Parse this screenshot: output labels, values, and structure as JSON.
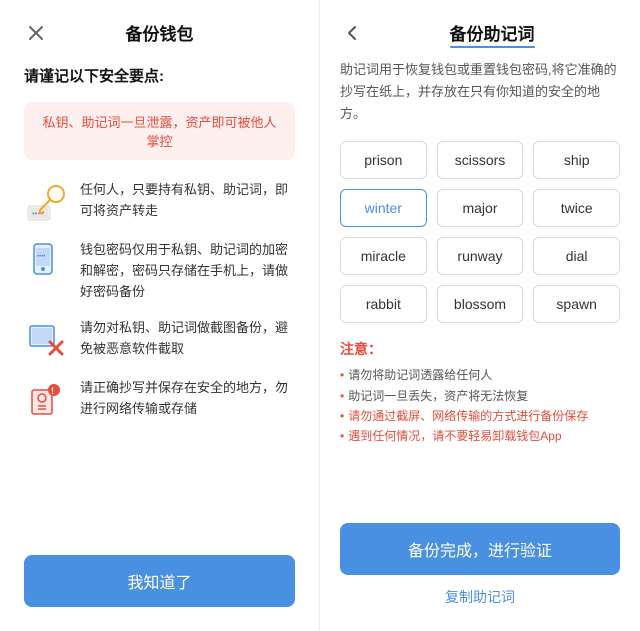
{
  "left": {
    "title": "备份钱包",
    "subtitle": "请谨记以下安全要点:",
    "warning": "私钥、助记词一旦泄露，资产即可被他人掌控",
    "security_items": [
      {
        "icon": "key-icon",
        "text": "任何人，只要持有私钥、助记词，即可将资产转走"
      },
      {
        "icon": "phone-icon",
        "text": "钱包密码仅用于私钥、助记词的加密和解密，密码只存储在手机上，请做好密码备份"
      },
      {
        "icon": "scan-icon",
        "text": "请勿对私钥、助记词做截图备份，避免被恶意软件截取"
      },
      {
        "icon": "save-icon",
        "text": "请正确抄写并保存在安全的地方，勿进行网络传输或存储"
      }
    ],
    "confirm_button": "我知道了"
  },
  "right": {
    "title": "备份助记词",
    "back_label": "‹",
    "description": "助记词用于恢复钱包或重置钱包密码,将它准确的抄写在纸上，并存放在只有你知道的安全的地方。",
    "words": [
      "prison",
      "scissors",
      "ship",
      "winter",
      "major",
      "twice",
      "miracle",
      "runway",
      "dial",
      "rabbit",
      "blossom",
      "spawn"
    ],
    "highlighted_word": "winter",
    "notes_title": "注意：",
    "notes": [
      {
        "text": "请勿将助记词透露给任何人",
        "red": false
      },
      {
        "text": "助记词一旦丢失，资产将无法恢复",
        "red": false
      },
      {
        "text": "请勿通过截屏、网络传输的方式进行备份保存",
        "red": true
      },
      {
        "text": "遇到任何情况，请不要轻易卸载钱包App",
        "red": true
      }
    ],
    "backup_button": "备份完成，进行验证",
    "copy_link": "复制助记词"
  }
}
